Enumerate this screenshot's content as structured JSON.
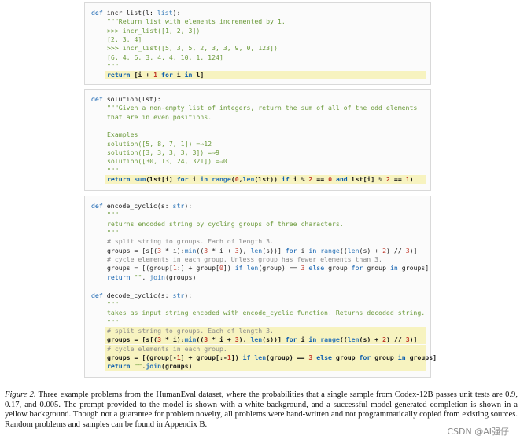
{
  "panels": [
    {
      "id": "incr_list",
      "lines": [
        {
          "hl": false,
          "t": [
            [
              "kw",
              "def"
            ],
            [
              "",
              "incr_list(l: "
            ],
            [
              "bi",
              "list"
            ],
            [
              "",
              "):"
            ]
          ]
        },
        {
          "hl": false,
          "ind": true,
          "t": [
            [
              "str",
              "\"\"\"Return list with elements incremented by 1."
            ]
          ]
        },
        {
          "hl": false,
          "ind": true,
          "t": [
            [
              "str",
              ">>> incr_list([1, 2, 3])"
            ]
          ]
        },
        {
          "hl": false,
          "ind": true,
          "t": [
            [
              "str",
              "[2, 3, 4]"
            ]
          ]
        },
        {
          "hl": false,
          "ind": true,
          "t": [
            [
              "str",
              ">>> incr_list([5, 3, 5, 2, 3, 3, 9, 0, 123])"
            ]
          ]
        },
        {
          "hl": false,
          "ind": true,
          "t": [
            [
              "str",
              "[6, 4, 6, 3, 4, 4, 10, 1, 124]"
            ]
          ]
        },
        {
          "hl": false,
          "ind": true,
          "t": [
            [
              "str",
              "\"\"\""
            ]
          ]
        },
        {
          "hl": true,
          "t": [
            [
              "kw",
              "return "
            ],
            [
              "",
              "[i + "
            ],
            [
              "num",
              "1"
            ],
            [
              "kw",
              " for "
            ],
            [
              "",
              "i "
            ],
            [
              "kw",
              "in "
            ],
            [
              "",
              "l]"
            ]
          ]
        }
      ]
    },
    {
      "id": "solution",
      "lines": [
        {
          "hl": false,
          "t": [
            [
              "kw",
              "def"
            ],
            [
              "",
              "solution(lst):"
            ]
          ]
        },
        {
          "hl": false,
          "ind": true,
          "t": [
            [
              "str",
              "\"\"\"Given a non-empty list of integers, return the sum of all of the odd elements"
            ]
          ]
        },
        {
          "hl": false,
          "ind": true,
          "t": [
            [
              "str",
              "that are in even positions."
            ]
          ]
        },
        {
          "hl": false,
          "ind": true,
          "t": [
            [
              "str",
              ""
            ]
          ]
        },
        {
          "hl": false,
          "ind": true,
          "t": [
            [
              "str",
              "Examples"
            ]
          ]
        },
        {
          "hl": false,
          "ind": true,
          "t": [
            [
              "str",
              "solution([5, 8, 7, 1]) =⇒12"
            ]
          ]
        },
        {
          "hl": false,
          "ind": true,
          "t": [
            [
              "str",
              "solution([3, 3, 3, 3, 3]) =⇒9"
            ]
          ]
        },
        {
          "hl": false,
          "ind": true,
          "t": [
            [
              "str",
              "solution([30, 13, 24, 321]) =⇒0"
            ]
          ]
        },
        {
          "hl": false,
          "ind": true,
          "t": [
            [
              "str",
              "\"\"\""
            ]
          ]
        },
        {
          "hl": true,
          "t": [
            [
              "kw",
              "return "
            ],
            [
              "bi",
              "sum"
            ],
            [
              "",
              "(lst[i] "
            ],
            [
              "kw",
              "for "
            ],
            [
              "",
              "i "
            ],
            [
              "kw",
              "in "
            ],
            [
              "bi",
              "range"
            ],
            [
              "",
              "("
            ],
            [
              "num",
              "0"
            ],
            [
              "",
              ","
            ],
            [
              "bi",
              "len"
            ],
            [
              "",
              "(lst)) "
            ],
            [
              "kw",
              "if "
            ],
            [
              "",
              "i % "
            ],
            [
              "num",
              "2"
            ],
            [
              "",
              " == "
            ],
            [
              "num",
              "0"
            ],
            [
              "kw",
              " and "
            ],
            [
              "",
              "lst[i] % "
            ],
            [
              "num",
              "2"
            ],
            [
              "",
              " == "
            ],
            [
              "num",
              "1"
            ],
            [
              "",
              ")"
            ]
          ]
        }
      ]
    },
    {
      "id": "cyclic",
      "lines": [
        {
          "hl": false,
          "t": [
            [
              "kw",
              "def"
            ],
            [
              "",
              "encode_cyclic(s: "
            ],
            [
              "bi",
              "str"
            ],
            [
              "",
              "):"
            ]
          ]
        },
        {
          "hl": false,
          "ind": true,
          "t": [
            [
              "str",
              "\"\"\""
            ]
          ]
        },
        {
          "hl": false,
          "ind": true,
          "t": [
            [
              "str",
              "returns encoded string by cycling groups of three characters."
            ]
          ]
        },
        {
          "hl": false,
          "ind": true,
          "t": [
            [
              "str",
              "\"\"\""
            ]
          ]
        },
        {
          "hl": false,
          "ind": true,
          "t": [
            [
              "cmt",
              "# split string to groups. Each of length 3."
            ]
          ]
        },
        {
          "hl": false,
          "ind": true,
          "t": [
            [
              "",
              "groups = [s[("
            ],
            [
              "num",
              "3"
            ],
            [
              "",
              " * i):"
            ],
            [
              "bi",
              "min"
            ],
            [
              "",
              "(("
            ],
            [
              "num",
              "3"
            ],
            [
              "",
              " * i + "
            ],
            [
              "num",
              "3"
            ],
            [
              "",
              "), "
            ],
            [
              "bi",
              "len"
            ],
            [
              "",
              "(s))] "
            ],
            [
              "kw",
              "for "
            ],
            [
              "",
              "i "
            ],
            [
              "kw",
              "in "
            ],
            [
              "bi",
              "range"
            ],
            [
              "",
              "(("
            ],
            [
              "bi",
              "len"
            ],
            [
              "",
              "(s) + "
            ],
            [
              "num",
              "2"
            ],
            [
              "",
              ") // "
            ],
            [
              "num",
              "3"
            ],
            [
              "",
              ")]"
            ]
          ]
        },
        {
          "hl": false,
          "ind": true,
          "t": [
            [
              "cmt",
              "# cycle elements in each group. Unless group has fewer elements than 3."
            ]
          ]
        },
        {
          "hl": false,
          "ind": true,
          "t": [
            [
              "",
              "groups = [(group["
            ],
            [
              "num",
              "1"
            ],
            [
              "",
              ":] + group["
            ],
            [
              "num",
              "0"
            ],
            [
              "",
              "]) "
            ],
            [
              "kw",
              "if "
            ],
            [
              "bi",
              "len"
            ],
            [
              "",
              "(group) == "
            ],
            [
              "num",
              "3"
            ],
            [
              "kw",
              " else "
            ],
            [
              "",
              "group "
            ],
            [
              "kw",
              "for "
            ],
            [
              "",
              "group "
            ],
            [
              "kw",
              "in "
            ],
            [
              "",
              "groups]"
            ]
          ]
        },
        {
          "hl": false,
          "ind": true,
          "t": [
            [
              "kw",
              "return "
            ],
            [
              "str",
              "\"\""
            ],
            [
              "",
              ". "
            ],
            [
              "bi",
              "join"
            ],
            [
              "",
              "(groups)"
            ]
          ]
        },
        {
          "hl": false,
          "t": [
            [
              "",
              ""
            ]
          ]
        },
        {
          "hl": false,
          "t": [
            [
              "kw",
              "def"
            ],
            [
              "",
              "decode_cyclic(s: "
            ],
            [
              "bi",
              "str"
            ],
            [
              "",
              "):"
            ]
          ]
        },
        {
          "hl": false,
          "ind": true,
          "t": [
            [
              "str",
              "\"\"\""
            ]
          ]
        },
        {
          "hl": false,
          "ind": true,
          "t": [
            [
              "str",
              "takes as input string encoded with encode_cyclic function. Returns decoded string."
            ]
          ]
        },
        {
          "hl": false,
          "ind": true,
          "t": [
            [
              "str",
              "\"\"\""
            ]
          ]
        },
        {
          "hl": true,
          "t": [
            [
              "cmt",
              "# split string to groups. Each of length 3."
            ]
          ]
        },
        {
          "hl": true,
          "t": [
            [
              "",
              "groups = [s[("
            ],
            [
              "num",
              "3"
            ],
            [
              "",
              " * i):"
            ],
            [
              "bi",
              "min"
            ],
            [
              "",
              "(("
            ],
            [
              "num",
              "3"
            ],
            [
              "",
              " * i + "
            ],
            [
              "num",
              "3"
            ],
            [
              "",
              "), "
            ],
            [
              "bi",
              "len"
            ],
            [
              "",
              "(s))] "
            ],
            [
              "kw",
              "for "
            ],
            [
              "",
              "i "
            ],
            [
              "kw",
              "in "
            ],
            [
              "bi",
              "range"
            ],
            [
              "",
              "(("
            ],
            [
              "bi",
              "len"
            ],
            [
              "",
              "(s) + "
            ],
            [
              "num",
              "2"
            ],
            [
              "",
              ") // "
            ],
            [
              "num",
              "3"
            ],
            [
              "",
              ")]"
            ]
          ]
        },
        {
          "hl": true,
          "t": [
            [
              "cmt",
              "# cycle elements in each group."
            ]
          ]
        },
        {
          "hl": true,
          "t": [
            [
              "",
              "groups = [(group[-"
            ],
            [
              "num",
              "1"
            ],
            [
              "",
              "] + group[:-"
            ],
            [
              "num",
              "1"
            ],
            [
              "",
              "]) "
            ],
            [
              "kw",
              "if "
            ],
            [
              "bi",
              "len"
            ],
            [
              "",
              "(group) == "
            ],
            [
              "num",
              "3"
            ],
            [
              "kw",
              " else "
            ],
            [
              "",
              "group "
            ],
            [
              "kw",
              "for "
            ],
            [
              "",
              "group "
            ],
            [
              "kw",
              "in "
            ],
            [
              "",
              "groups]"
            ]
          ]
        },
        {
          "hl": true,
          "t": [
            [
              "kw",
              "return "
            ],
            [
              "str",
              "\"\""
            ],
            [
              "",
              "."
            ],
            [
              "bi",
              "join"
            ],
            [
              "",
              "(groups)"
            ]
          ]
        }
      ]
    }
  ],
  "caption": {
    "label": "Figure 2.",
    "text": " Three example problems from the HumanEval dataset, where the probabilities that a single sample from Codex-12B passes unit tests are 0.9, 0.17, and 0.005. The prompt provided to the model is shown with a white background, and a successful model-generated completion is shown in a yellow background. Though not a guarantee for problem novelty, all problems were hand-written and not programmatically copied from existing sources. Random problems and samples can be found in Appendix B."
  },
  "watermark": "CSDN @AI强仔"
}
